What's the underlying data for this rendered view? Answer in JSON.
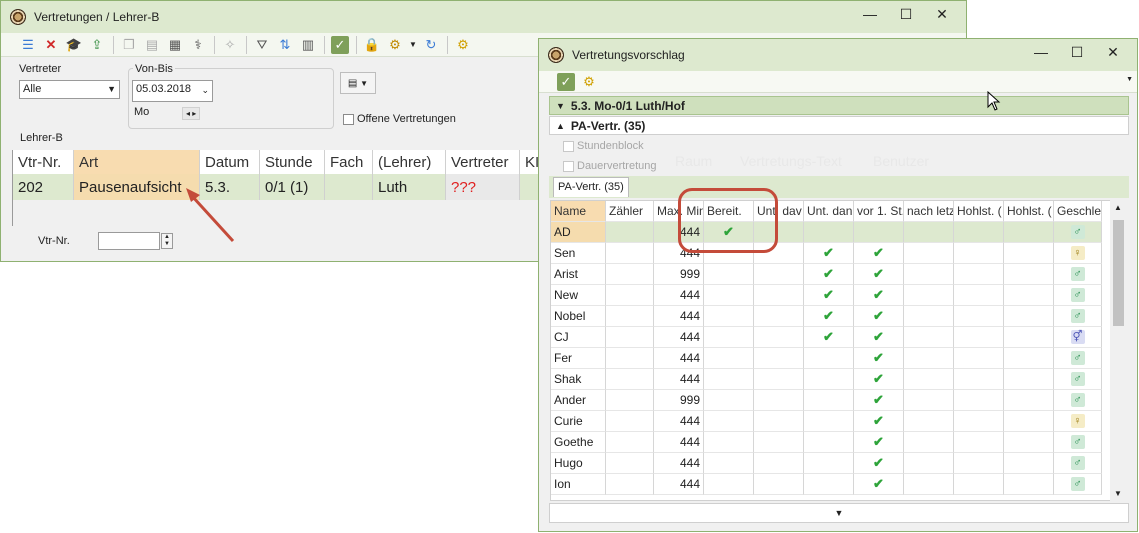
{
  "win1": {
    "title": "Vertretungen / Lehrer-B",
    "controls": {
      "minimize": "—",
      "maximize": "☐",
      "close": "✕"
    },
    "vertreter_label": "Vertreter",
    "vertreter_value": "Alle",
    "vonbis_label": "Von-Bis",
    "date_value": "05.03.2018",
    "day_value": "Mo",
    "offene_label": "Offene Vertretungen",
    "lehrer_label": "Lehrer-B",
    "columns": [
      "Vtr-Nr.",
      "Art",
      "Datum",
      "Stunde",
      "Fach",
      "(Lehrer)",
      "Vertreter",
      "KI"
    ],
    "row": [
      "202",
      "Pausenaufsicht",
      "5.3.",
      "0/1 (1)",
      "",
      "Luth",
      "???",
      ""
    ],
    "vtrnr_label": "Vtr-Nr.",
    "vtrnr_value": ""
  },
  "win2": {
    "title": "Vertretungsvorschlag",
    "controls": {
      "minimize": "—",
      "maximize": "☐",
      "close": "✕"
    },
    "bar1": "5.3. Mo-0/1 Luth/Hof",
    "bar2": "PA-Vertr. (35)",
    "stundenblock": "Stundenblock",
    "dauervertretung": "Dauervertretung",
    "ghost_labels": [
      "Raum",
      "Vertretungs-Text",
      "Benutzer"
    ],
    "tab": "PA-Vertr. (35)",
    "columns": [
      "Name",
      "Zähler",
      "Max. Min",
      "Bereit.",
      "Unt. dav",
      "Unt. dan",
      "vor 1. St.",
      "nach letz",
      "Hohlst. (",
      "Hohlst. (",
      "Geschle"
    ],
    "rows": [
      {
        "name": "AD",
        "max": "444",
        "bereit": true,
        "dav": false,
        "dan": false,
        "vor": false,
        "g": "m"
      },
      {
        "name": "Sen",
        "max": "444",
        "bereit": false,
        "dav": false,
        "dan": true,
        "vor": true,
        "g": "f"
      },
      {
        "name": "Arist",
        "max": "999",
        "bereit": false,
        "dav": false,
        "dan": true,
        "vor": true,
        "g": "m"
      },
      {
        "name": "New",
        "max": "444",
        "bereit": false,
        "dav": false,
        "dan": true,
        "vor": true,
        "g": "m"
      },
      {
        "name": "Nobel",
        "max": "444",
        "bereit": false,
        "dav": false,
        "dan": true,
        "vor": true,
        "g": "m"
      },
      {
        "name": "CJ",
        "max": "444",
        "bereit": false,
        "dav": false,
        "dan": true,
        "vor": true,
        "g": "x"
      },
      {
        "name": "Fer",
        "max": "444",
        "bereit": false,
        "dav": false,
        "dan": false,
        "vor": true,
        "g": "m"
      },
      {
        "name": "Shak",
        "max": "444",
        "bereit": false,
        "dav": false,
        "dan": false,
        "vor": true,
        "g": "m"
      },
      {
        "name": "Ander",
        "max": "999",
        "bereit": false,
        "dav": false,
        "dan": false,
        "vor": true,
        "g": "m"
      },
      {
        "name": "Curie",
        "max": "444",
        "bereit": false,
        "dav": false,
        "dan": false,
        "vor": true,
        "g": "f"
      },
      {
        "name": "Goethe",
        "max": "444",
        "bereit": false,
        "dav": false,
        "dan": false,
        "vor": true,
        "g": "m"
      },
      {
        "name": "Hugo",
        "max": "444",
        "bereit": false,
        "dav": false,
        "dan": false,
        "vor": true,
        "g": "m"
      },
      {
        "name": "Ion",
        "max": "444",
        "bereit": false,
        "dav": false,
        "dan": false,
        "vor": true,
        "g": "m"
      }
    ]
  },
  "colors": {
    "accent_green": "#dde9cf",
    "highlight_orange": "#f5dcae",
    "callout_red": "#c44b3a",
    "check_green": "#2ea43a"
  }
}
